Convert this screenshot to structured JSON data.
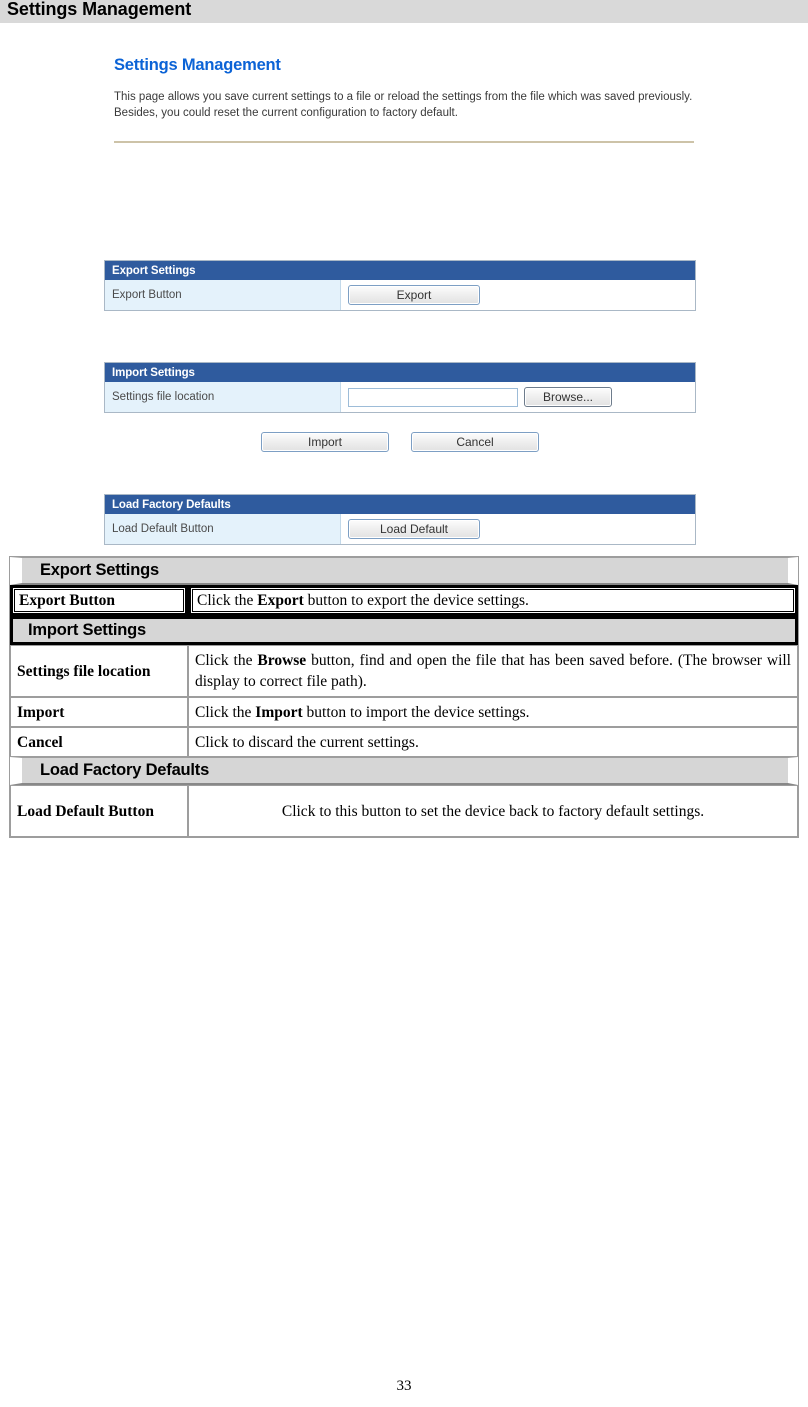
{
  "page": {
    "running_head": "Settings Management",
    "number": "33"
  },
  "ui": {
    "title": "Settings Management",
    "description": "This page allows you save current settings to a file or reload the settings from the file which was saved previously. Besides, you could reset the current configuration to factory default.",
    "export_panel": {
      "header": "Export Settings",
      "row_label": "Export Button",
      "button": "Export"
    },
    "import_panel": {
      "header": "Import Settings",
      "row_label": "Settings file location",
      "file_value": "",
      "file_placeholder": "",
      "browse_button": "Browse...",
      "import_button": "Import",
      "cancel_button": "Cancel"
    },
    "defaults_panel": {
      "header": "Load Factory Defaults",
      "row_label": "Load Default Button",
      "button": "Load Default"
    }
  },
  "desc_table": {
    "sections": [
      {
        "title": "Export Settings",
        "rows": [
          {
            "key": "Export Button",
            "value_pre": "Click the ",
            "value_bold": "Export",
            "value_post": " button to export the device settings."
          }
        ]
      },
      {
        "title": "Import Settings",
        "rows": [
          {
            "key": "Settings file location",
            "value_pre": "Click the ",
            "value_bold": "Browse",
            "value_post": " button, find and open the file that has been saved before. (The browser will display to correct file path)."
          },
          {
            "key": "Import",
            "value_pre": "Click the ",
            "value_bold": "Import",
            "value_post": " button to import the device settings."
          },
          {
            "key": "Cancel",
            "value_pre": "Click to discard the current settings.",
            "value_bold": "",
            "value_post": ""
          }
        ]
      },
      {
        "title": "Load Factory Defaults",
        "rows": [
          {
            "key": "Load Default Button",
            "value_pre": "Click to this button to set the device back to factory default settings.",
            "value_bold": "",
            "value_post": ""
          }
        ]
      }
    ]
  },
  "colors": {
    "running_head_bg": "#d9d9d9",
    "panel_header_blue": "#2f5b9e",
    "panel_label_bg": "#e4f2fb",
    "ui_title_blue": "#0b63d6",
    "rule_tan": "#cdc3a8",
    "section_row_gray": "#d6d6d6"
  }
}
